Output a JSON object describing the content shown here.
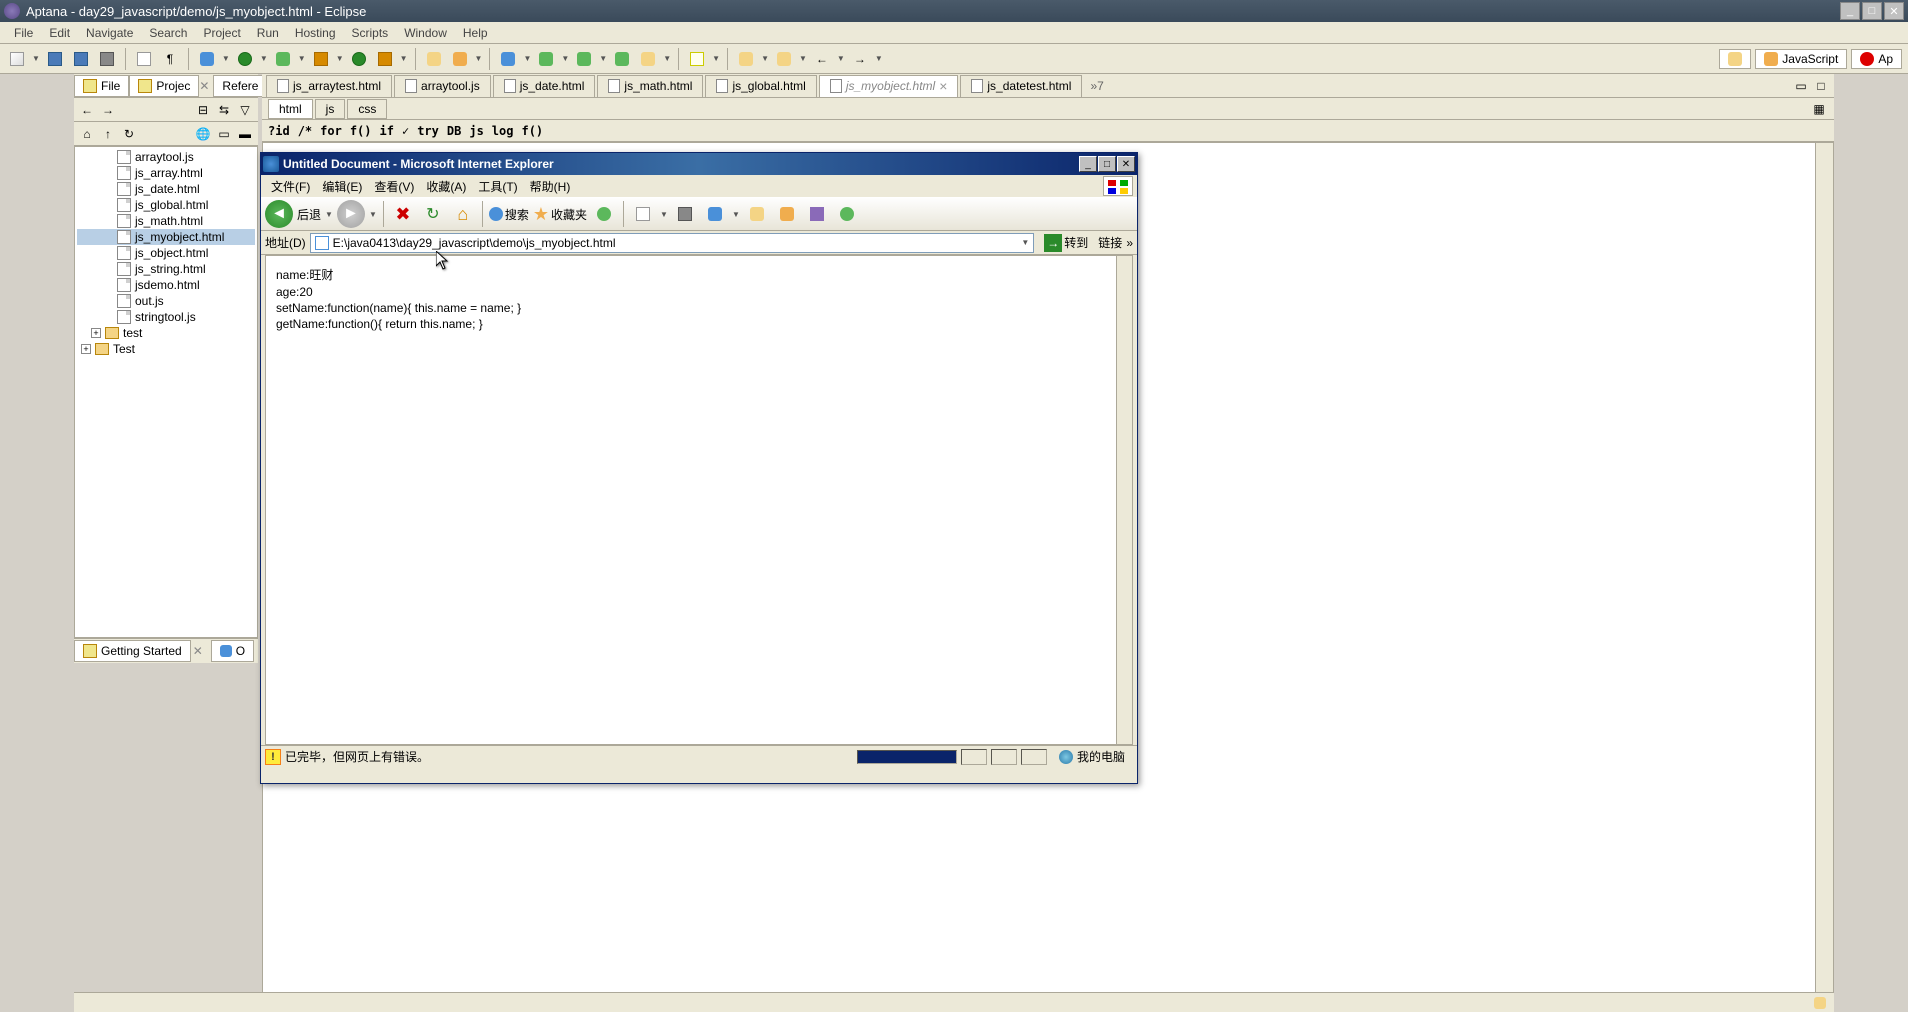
{
  "eclipse": {
    "title": "Aptana - day29_javascript/demo/js_myobject.html - Eclipse",
    "menu": [
      "File",
      "Edit",
      "Navigate",
      "Search",
      "Project",
      "Run",
      "Hosting",
      "Scripts",
      "Window",
      "Help"
    ],
    "perspective_label": "JavaScript",
    "perspective_alt": "Ap"
  },
  "left_panel": {
    "tab_file": "File",
    "tab_project": "Projec",
    "tab_refere": "Refere",
    "tree_files": [
      "arraytool.js",
      "js_array.html",
      "js_date.html",
      "js_global.html",
      "js_math.html",
      "js_myobject.html",
      "js_object.html",
      "js_string.html",
      "jsdemo.html",
      "out.js",
      "stringtool.js"
    ],
    "folder_test": "test",
    "folder_Test": "Test",
    "selected_file": "js_myobject.html",
    "bottom_tab": "Getting Started",
    "bottom_tab2": "O"
  },
  "editor": {
    "tabs": [
      "js_arraytest.html",
      "arraytool.js",
      "js_date.html",
      "js_math.html",
      "js_global.html",
      "js_myobject.html",
      "js_datetest.html"
    ],
    "active_tab": "js_myobject.html",
    "overflow": "»7",
    "subtabs": [
      "html",
      "js",
      "css"
    ],
    "subtab_active": "html",
    "inserts": [
      "?id",
      "/*",
      "for",
      "f()",
      "if",
      "✓",
      "try",
      "DB",
      "js",
      "log",
      "f()"
    ]
  },
  "ie": {
    "title": "Untitled Document - Microsoft Internet Explorer",
    "menu": [
      "文件(F)",
      "编辑(E)",
      "查看(V)",
      "收藏(A)",
      "工具(T)",
      "帮助(H)"
    ],
    "btn_back": "后退",
    "btn_search": "搜索",
    "btn_fav": "收藏夹",
    "addr_label": "地址(D)",
    "addr_value": "E:\\java0413\\day29_javascript\\demo\\js_myobject.html",
    "btn_go": "转到",
    "btn_links": "链接",
    "more": "»",
    "content_lines": [
      "name:旺财",
      "age:20",
      "setName:function(name){ this.name = name; }",
      "getName:function(){ return this.name; }"
    ],
    "status_text": "已完毕，但网页上有错误。",
    "status_zone": "我的电脑"
  }
}
